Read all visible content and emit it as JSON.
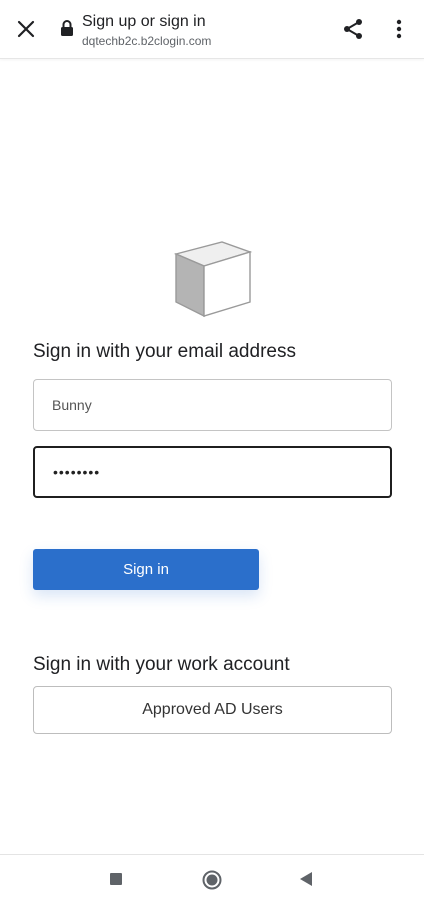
{
  "browser": {
    "title": "Sign up or sign in",
    "url": "dqtechb2c.b2clogin.com",
    "icons": {
      "close": "close-icon",
      "lock": "lock-icon",
      "share": "share-icon",
      "menu": "more-vert-icon"
    }
  },
  "signin": {
    "email_heading": "Sign in with your email address",
    "username_value": "Bunny",
    "password_value": "••••••••",
    "submit_label": "Sign in"
  },
  "work": {
    "heading": "Sign in with your work account",
    "provider_label": "Approved AD Users"
  },
  "colors": {
    "accent": "#2b6fcb",
    "border": "#c4c4c4",
    "focus_border": "#1f1f1f"
  },
  "nav": {
    "recents": "square-icon",
    "home": "home-circle-icon",
    "back": "back-triangle-icon"
  }
}
